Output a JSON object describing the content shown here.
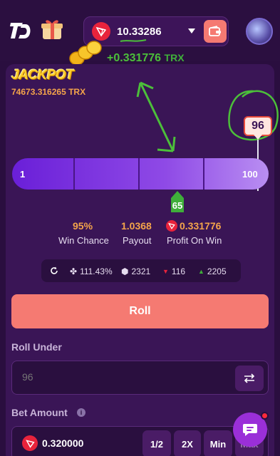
{
  "header": {
    "balance": "10.33286",
    "gain_amount": "+0.331776",
    "gain_unit": "TRX"
  },
  "jackpot": {
    "title": "JACKPOT",
    "amount": "74673.316265 TRX"
  },
  "dice": {
    "result": "96",
    "slider_min": "1",
    "slider_max": "100",
    "roll_under_value": "65",
    "roll_under_fraction": 0.65,
    "result_fraction": 0.96
  },
  "stats": {
    "win_chance_value": "95%",
    "win_chance_label": "Win Chance",
    "payout_value": "1.0368",
    "payout_label": "Payout",
    "profit_value": "0.331776",
    "profit_label": "Profit On Win"
  },
  "info_bar": {
    "luck": "111.43%",
    "total": "2321",
    "losses": "116",
    "wins": "2205"
  },
  "roll_button": "Roll",
  "roll_under": {
    "label": "Roll Under",
    "placeholder": "96"
  },
  "bet": {
    "label": "Bet Amount",
    "value": "0.320000",
    "half": "1/2",
    "double": "2X",
    "min": "Min",
    "max": "Max"
  },
  "colors": {
    "accent": "#f57a72",
    "gold": "#f4a44a",
    "purple": "#6a1fd8",
    "green": "#4cbf3a"
  }
}
